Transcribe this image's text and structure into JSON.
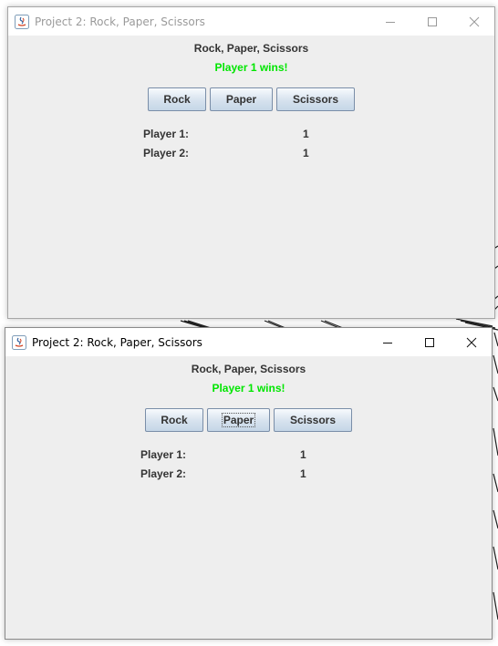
{
  "colors": {
    "status": "#00e600",
    "window_bg": "#eeeeee",
    "button_border": "#7a8ea8"
  },
  "windows": [
    {
      "title": "Project 2: Rock, Paper, Scissors",
      "active": false,
      "heading": "Rock, Paper, Scissors",
      "status": "Player 1 wins!",
      "buttons": {
        "rock": "Rock",
        "paper": "Paper",
        "scissors": "Scissors"
      },
      "focused_button": "",
      "scores": [
        {
          "label": "Player 1:",
          "value": "1"
        },
        {
          "label": "Player 2:",
          "value": "1"
        }
      ]
    },
    {
      "title": "Project 2: Rock, Paper, Scissors",
      "active": true,
      "heading": "Rock, Paper, Scissors",
      "status": "Player 1 wins!",
      "buttons": {
        "rock": "Rock",
        "paper": "Paper",
        "scissors": "Scissors"
      },
      "focused_button": "paper",
      "scores": [
        {
          "label": "Player 1:",
          "value": "1"
        },
        {
          "label": "Player 2:",
          "value": "1"
        }
      ]
    }
  ]
}
